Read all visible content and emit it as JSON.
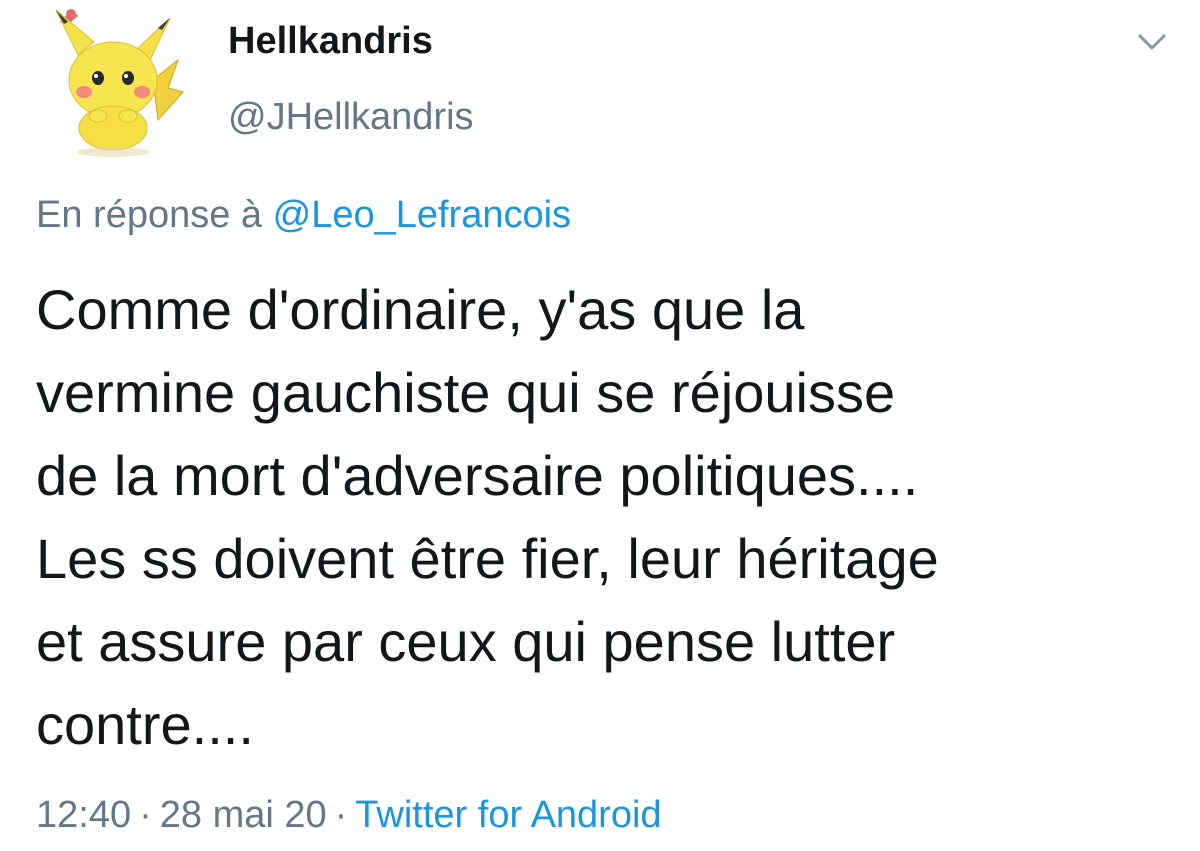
{
  "author": {
    "display_name": "Hellkandris",
    "handle": "@JHellkandris",
    "avatar_icon": "pikachu-avatar"
  },
  "menu": {
    "icon": "chevron-down-icon"
  },
  "reply": {
    "prefix": "En réponse à",
    "mention": "@Leo_Lefrancois"
  },
  "tweet": {
    "text": "Comme d'ordinaire, y'as que la\nvermine gauchiste qui se réjouisse\nde la mort d'adversaire politiques....\nLes ss doivent être fier, leur héritage\net assure par ceux qui pense lutter\ncontre...."
  },
  "meta": {
    "time": "12:40",
    "date": "28 mai 20",
    "separator": "·",
    "source": "Twitter for Android"
  },
  "colors": {
    "text_primary": "#14171a",
    "text_secondary": "#657786",
    "link": "#1b95e0"
  }
}
